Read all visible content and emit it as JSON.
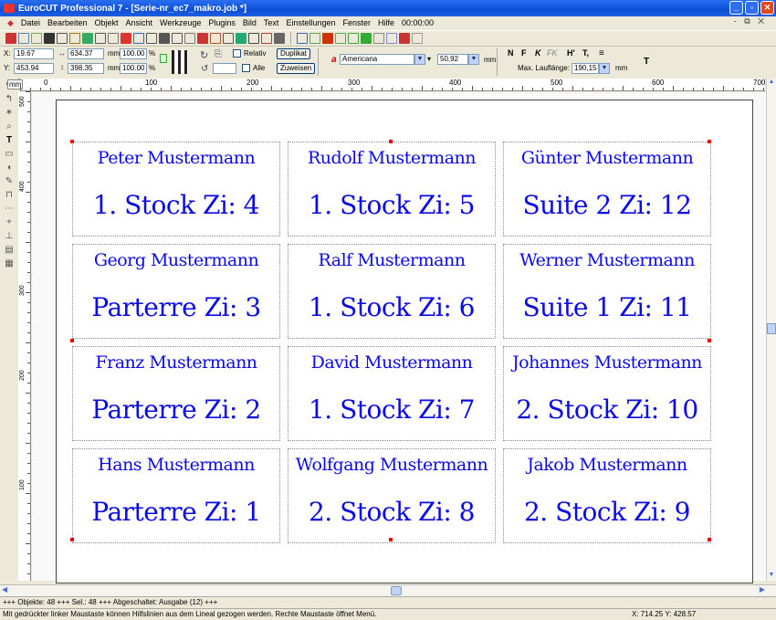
{
  "window": {
    "title": "EuroCUT Professional 7 - [Serie-nr_ec7_makro.job *]"
  },
  "menu": {
    "items": [
      "Datei",
      "Bearbeiten",
      "Objekt",
      "Ansicht",
      "Werkzeuge",
      "Plugins",
      "Bild",
      "Text",
      "Einstellungen",
      "Fenster",
      "Hilfe"
    ],
    "time": "00:00:00",
    "doc_controls": "- ⧉ ✕"
  },
  "props": {
    "x_label": "X:",
    "x_value": "19.67",
    "y_label": "Y:",
    "y_value": "453.94",
    "w_value": "634.37",
    "h_value": "398.35",
    "unit": "mm",
    "scale_x": "100.00",
    "scale_y": "100.00",
    "percent": "%",
    "relativ_label": "Relativ",
    "alle_label": "Alle",
    "duplikat_label": "Duplikat",
    "zuweisen_label": "Zuweisen"
  },
  "font": {
    "name": "Americana",
    "size": "50,92",
    "unit": "mm",
    "bold": "N",
    "bold2": "F",
    "italic": "K",
    "italic2": "FK",
    "sup": "H'",
    "sub": "T,",
    "max_label": "Max. Lauflänge:",
    "max_value": "190,15",
    "max_unit": "mm",
    "t_label": "T"
  },
  "ruler": {
    "unit": "mm",
    "top_ticks": [
      "0",
      "100",
      "200",
      "300",
      "400",
      "500",
      "600",
      "700"
    ],
    "left_ticks": [
      "500",
      "400",
      "300",
      "200",
      "100"
    ]
  },
  "labels": [
    {
      "name": "Peter Mustermann",
      "room": "1. Stock Zi: 4"
    },
    {
      "name": "Rudolf Mustermann",
      "room": "1. Stock Zi: 5"
    },
    {
      "name": "Günter Mustermann",
      "room": "Suite 2 Zi: 12"
    },
    {
      "name": "Georg Mustermann",
      "room": "Parterre Zi: 3"
    },
    {
      "name": "Ralf Mustermann",
      "room": "1. Stock Zi: 6"
    },
    {
      "name": "Werner Mustermann",
      "room": "Suite 1 Zi: 11"
    },
    {
      "name": "Franz Mustermann",
      "room": "Parterre Zi: 2"
    },
    {
      "name": "David Mustermann",
      "room": "1. Stock Zi: 7"
    },
    {
      "name": "Johannes Mustermann",
      "room": "2. Stock Zi: 10"
    },
    {
      "name": "Hans Mustermann",
      "room": "Parterre Zi: 1"
    },
    {
      "name": "Wolfgang Mustermann",
      "room": "2. Stock Zi: 8"
    },
    {
      "name": "Jakob Mustermann",
      "room": "2. Stock Zi: 9"
    }
  ],
  "status": {
    "objects": "+++ Objekte: 48 +++ Sel.: 48 +++ Abgeschaltet:  Ausgabe (12) +++",
    "hint": "Mit gedrückter linker Maustaste können Hilfslinien aus dem Lineal gezogen werden. Rechte Maustaste öffnet Menü.",
    "coords": "X: 714.25 Y: 428.57"
  },
  "colors": {
    "text_blue": "#0a0ae6",
    "handle_red": "#e00000",
    "titlebar": "#0a4fd8"
  }
}
